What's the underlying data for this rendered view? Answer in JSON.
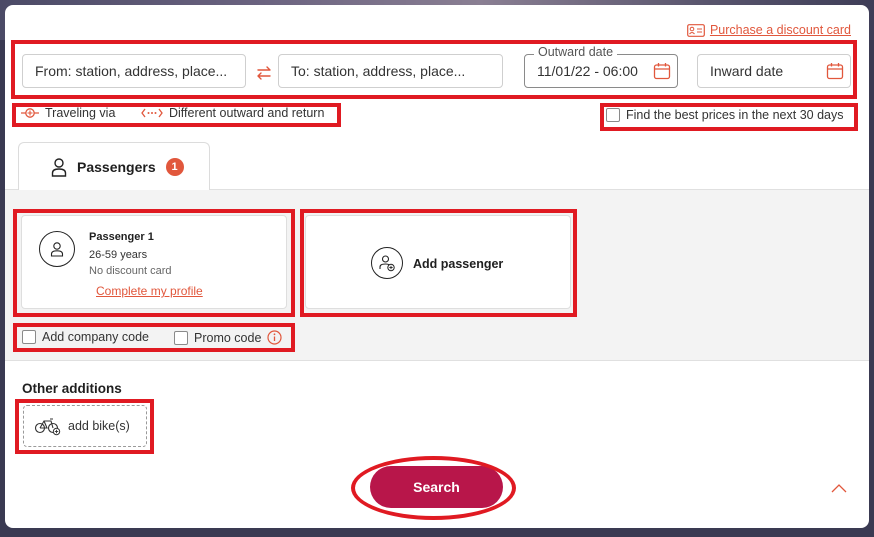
{
  "header": {
    "discount_link": "Purchase a discount card"
  },
  "journey": {
    "from_placeholder": "From: station, address, place...",
    "to_placeholder": "To: station, address, place...",
    "outward_label": "Outward date",
    "outward_value": "11/01/22 - 06:00",
    "inward_placeholder": "Inward date"
  },
  "options": {
    "traveling_via": "Traveling via",
    "different_outward_return": "Different outward and return",
    "best_prices": "Find the best prices in the next 30 days"
  },
  "tabs": {
    "passengers_label": "Passengers",
    "passengers_count": "1"
  },
  "passenger": {
    "name": "Passenger 1",
    "age": "26-59 years",
    "discount": "No discount card",
    "profile_link": "Complete my profile"
  },
  "add_passenger": "Add passenger",
  "codes": {
    "company": "Add company code",
    "promo": "Promo code"
  },
  "additions": {
    "title": "Other additions",
    "bike": "add bike(s)"
  },
  "search_label": "Search",
  "colors": {
    "accent": "#e1573c",
    "primary_button": "#b8164a",
    "highlight": "#e01a22"
  }
}
